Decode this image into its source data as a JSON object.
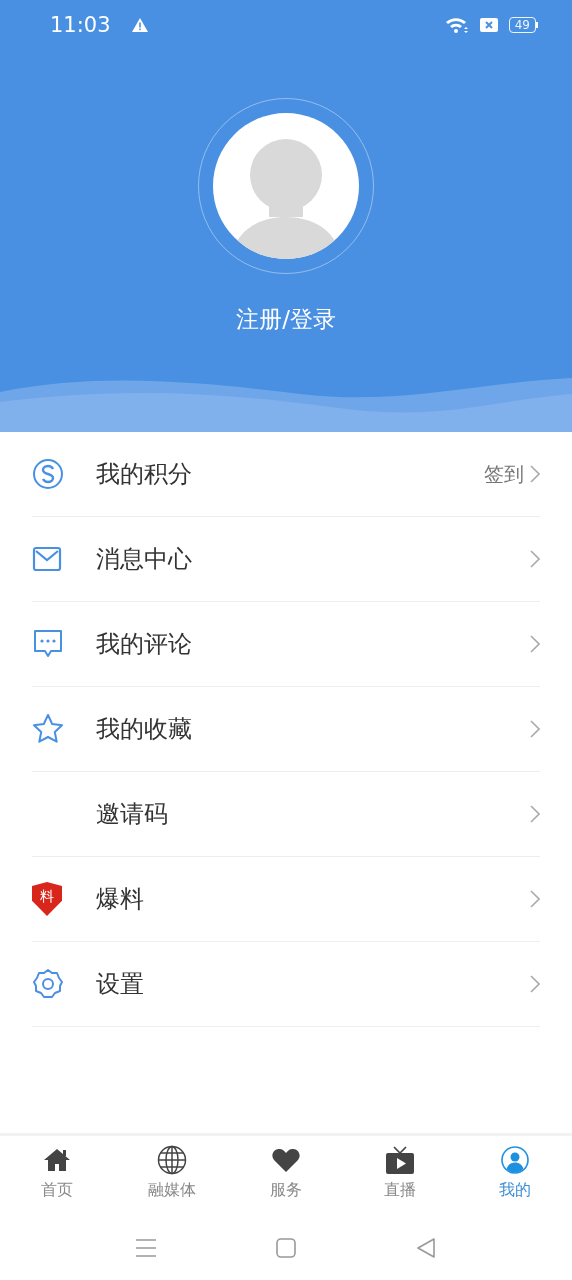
{
  "status_bar": {
    "time": "11:03",
    "battery": "49"
  },
  "profile": {
    "login_label": "注册/登录"
  },
  "menu": [
    {
      "kind": "points",
      "label": "我的积分",
      "action": "签到"
    },
    {
      "kind": "message",
      "label": "消息中心"
    },
    {
      "kind": "comment",
      "label": "我的评论"
    },
    {
      "kind": "star",
      "label": "我的收藏"
    },
    {
      "kind": "none",
      "label": "邀请码"
    },
    {
      "kind": "report",
      "label": "爆料",
      "badge": "料"
    },
    {
      "kind": "settings",
      "label": "设置"
    }
  ],
  "tabs": [
    {
      "kind": "home",
      "label": "首页",
      "selected": false
    },
    {
      "kind": "globe",
      "label": "融媒体",
      "selected": false
    },
    {
      "kind": "heart",
      "label": "服务",
      "selected": false
    },
    {
      "kind": "tv",
      "label": "直播",
      "selected": false
    },
    {
      "kind": "user",
      "label": "我的",
      "selected": true
    }
  ]
}
